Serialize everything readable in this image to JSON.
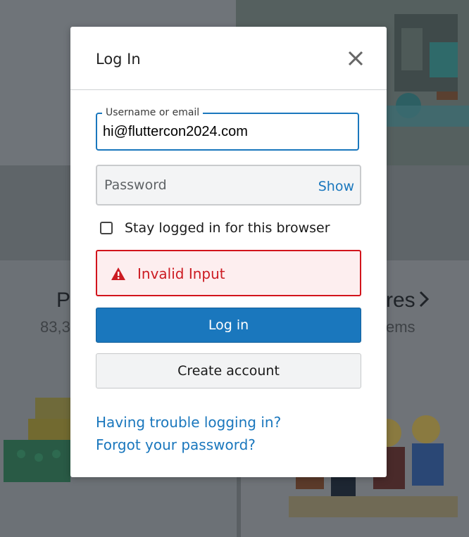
{
  "background": {
    "left_card": {
      "heading": "P",
      "count": "83,3"
    },
    "right_card": {
      "heading": "res",
      "count": "ems"
    }
  },
  "modal": {
    "title": "Log In",
    "close_icon": "close-icon",
    "username": {
      "legend": "Username or email",
      "value": "hi@fluttercon2024.com"
    },
    "password": {
      "placeholder": "Password",
      "show_label": "Show"
    },
    "stay_logged_in": {
      "label": "Stay logged in for this browser",
      "checked": false
    },
    "error": {
      "icon": "warning-icon",
      "message": "Invalid Input"
    },
    "login_button": "Log in",
    "create_account_button": "Create account",
    "links": {
      "trouble": "Having trouble logging in?",
      "forgot": "Forgot your password?"
    }
  },
  "colors": {
    "accent": "#1a77bd",
    "error": "#d2141c",
    "error_bg": "#fdeeef",
    "overlay": "#6e7378"
  }
}
